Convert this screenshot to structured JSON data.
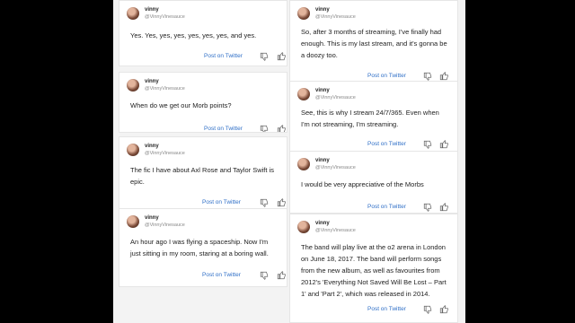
{
  "colors": {
    "background": "#000000",
    "panel": "#f3f3f3",
    "card": "#ffffff",
    "link": "#2f6fc7"
  },
  "icons": [
    "thumbs-down-icon",
    "thumbs-up-icon"
  ],
  "post_label": "Post on Twitter",
  "cards": [
    {
      "username": "vinny",
      "handle": "@VinnyVinesauce",
      "text": "Yes. Yes, yes, yes, yes, yes, yes, and yes."
    },
    {
      "username": "vinny",
      "handle": "@VinnyVinesauce",
      "text": "When do we get our Morb points?"
    },
    {
      "username": "vinny",
      "handle": "@VinnyVinesauce",
      "text": "The fic I have about Axl Rose and Taylor Swift is epic."
    },
    {
      "username": "vinny",
      "handle": "@VinnyVinesauce",
      "text": "An hour ago I was flying a spaceship. Now I'm just sitting in my room, staring at a boring wall."
    },
    {
      "username": "vinny",
      "handle": "@VinnyVinesauce",
      "text": "So, after 3 months of streaming, I've finally had enough. This is my last stream, and it's gonna be a doozy too."
    },
    {
      "username": "vinny",
      "handle": "@VinnyVinesauce",
      "text": "See, this is why I stream 24/7/365. Even when I'm not streaming, I'm streaming."
    },
    {
      "username": "vinny",
      "handle": "@VinnyVinesauce",
      "text": "I would be very appreciative of the Morbs"
    },
    {
      "username": "vinny",
      "handle": "@VinnyVinesauce",
      "text": "The band will play live at the o2 arena in London on June 18, 2017. The band will perform songs from the new album, as well as favourites from 2012's 'Everything Not Saved Will Be Lost – Part 1' and 'Part 2', which was released in 2014."
    }
  ]
}
